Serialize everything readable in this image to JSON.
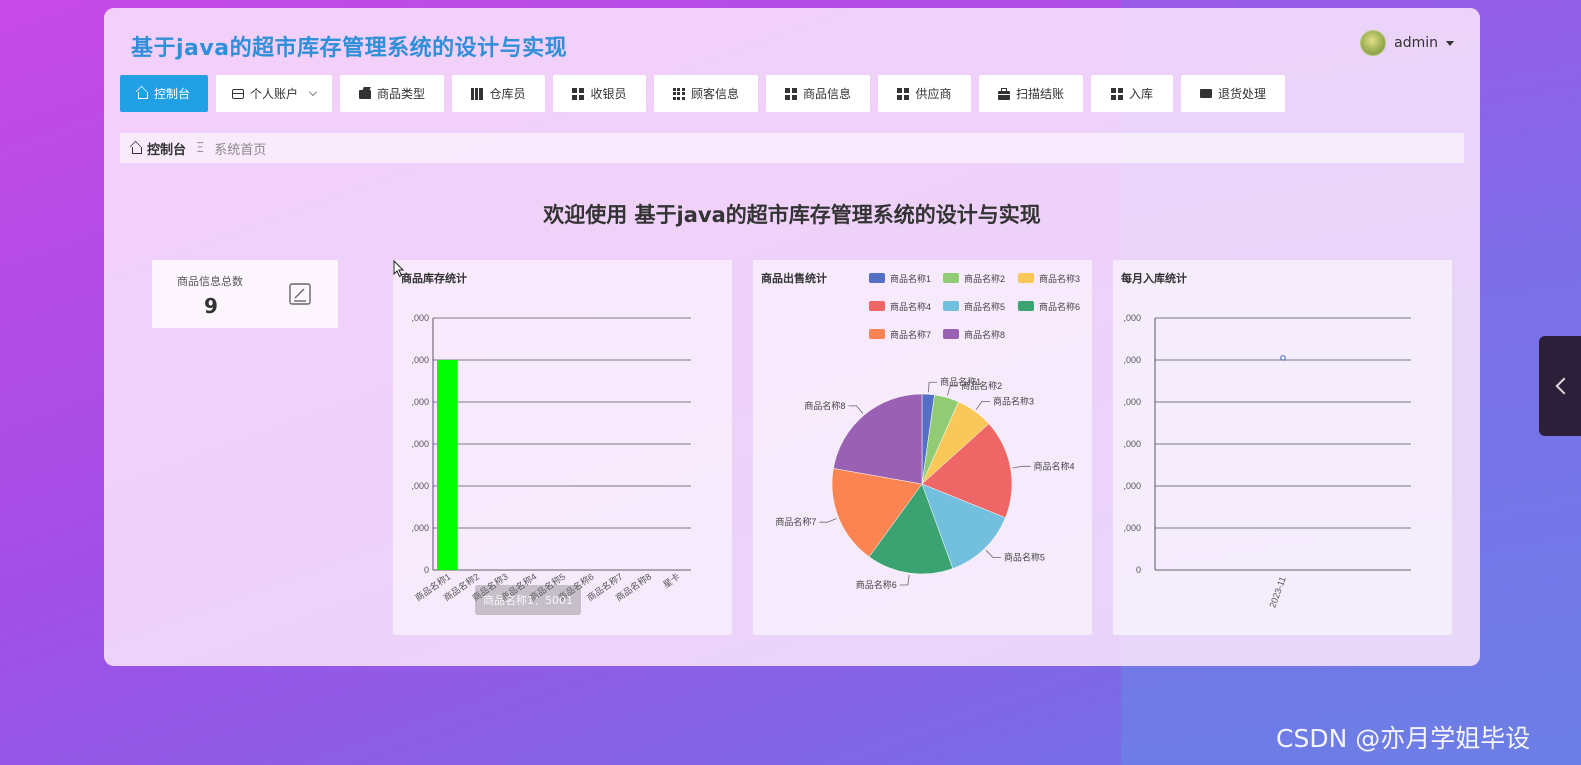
{
  "app": {
    "title": "基于java的超市库存管理系统的设计与实现",
    "user": "admin"
  },
  "nav": {
    "items": [
      {
        "label": "控制台",
        "icon": "home-icon",
        "active": true
      },
      {
        "label": "个人账户",
        "icon": "wallet-icon",
        "dropdown": true
      },
      {
        "label": "商品类型",
        "icon": "folder-icon"
      },
      {
        "label": "仓库员",
        "icon": "book-icon"
      },
      {
        "label": "收银员",
        "icon": "grid-icon"
      },
      {
        "label": "顾客信息",
        "icon": "grid9-icon"
      },
      {
        "label": "商品信息",
        "icon": "grid-icon"
      },
      {
        "label": "供应商",
        "icon": "grid-icon"
      },
      {
        "label": "扫描结账",
        "icon": "bag-icon"
      },
      {
        "label": "入库",
        "icon": "grid-icon"
      },
      {
        "label": "退货处理",
        "icon": "chat-icon"
      }
    ]
  },
  "breadcrumb": {
    "home": "控制台",
    "separator": "Ξ",
    "current": "系统首页"
  },
  "welcome": "欢迎使用 基于java的超市库存管理系统的设计与实现",
  "stat": {
    "label": "商品信息总数",
    "value": "9"
  },
  "colors": {
    "accent": "#22a0e6",
    "title": "#2f8fd8",
    "bar": "#00ff00"
  },
  "tooltip": "商品名称1：5001",
  "watermark": "CSDN @亦月学姐毕设",
  "chart_data": [
    {
      "type": "bar",
      "title": "商品库存统计",
      "categories": [
        "商品名称1",
        "商品名称2",
        "商品名称3",
        "商品名称4",
        "商品名称5",
        "商品名称6",
        "商品名称7",
        "商品名称8",
        "星卡"
      ],
      "values": [
        5001,
        0,
        0,
        0,
        0,
        0,
        0,
        0,
        0
      ],
      "y_tick_labels": [
        ",000",
        ",000",
        ",000",
        ",000",
        ",000",
        ",000",
        "0"
      ],
      "ylim": [
        0,
        6000
      ],
      "grid": true
    },
    {
      "type": "pie",
      "title": "商品出售统计",
      "labels": [
        "商品名称1",
        "商品名称2",
        "商品名称3",
        "商品名称4",
        "商品名称5",
        "商品名称6",
        "商品名称7",
        "商品名称8"
      ],
      "values": [
        2,
        4,
        6,
        16,
        12,
        14,
        16,
        20
      ],
      "colors": [
        "#5470c6",
        "#91cc75",
        "#fac858",
        "#ee6666",
        "#73c0de",
        "#3ba272",
        "#fc8452",
        "#9a60b4"
      ],
      "legend": "top-right"
    },
    {
      "type": "scatter",
      "title": "每月入库统计",
      "x": [
        "2023-11"
      ],
      "y": [
        5050
      ],
      "y_tick_labels": [
        ",000",
        ",000",
        ",000",
        ",000",
        ",000",
        ",000",
        "0"
      ],
      "ylim": [
        0,
        6000
      ],
      "grid": true
    }
  ]
}
